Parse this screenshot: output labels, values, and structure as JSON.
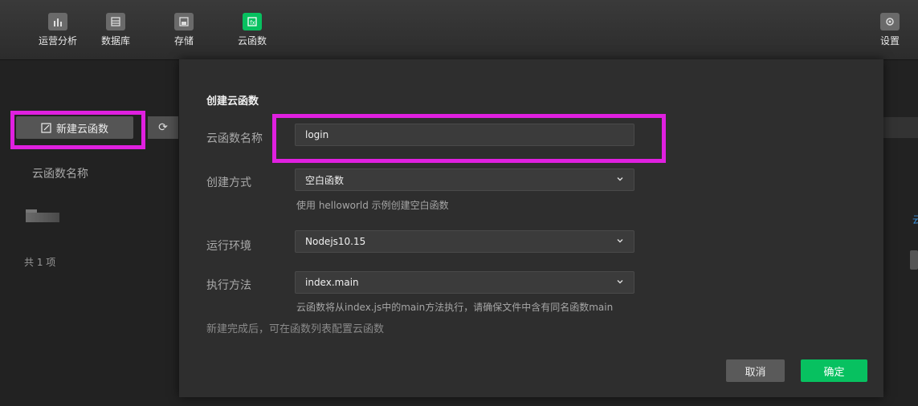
{
  "topnav": {
    "items": [
      {
        "label": "运营分析",
        "icon": "bar-chart-icon"
      },
      {
        "label": "数据库",
        "icon": "database-icon"
      },
      {
        "label": "存储",
        "icon": "storage-icon"
      },
      {
        "label": "云函数",
        "icon": "cloud-function-icon",
        "active": true
      }
    ],
    "settings_label": "设置"
  },
  "background": {
    "new_button_label": "新建云函数",
    "column_header": "云函数名称",
    "total_text": "共 1 项",
    "right_edge_text": "云"
  },
  "dialog": {
    "title": "创建云函数",
    "name_label": "云函数名称",
    "name_value": "login",
    "method_label": "创建方式",
    "method_value": "空白函数",
    "method_hint": "使用 helloworld 示例创建空白函数",
    "runtime_label": "运行环境",
    "runtime_value": "Nodejs10.15",
    "handler_label": "执行方法",
    "handler_value": "index.main",
    "handler_hint": "云函数将从index.js中的main方法执行，请确保文件中含有同名函数main",
    "footnote": "新建完成后，可在函数列表配置云函数",
    "cancel_label": "取消",
    "confirm_label": "确定"
  },
  "colors": {
    "accent": "#07c160",
    "highlight": "#e020e0"
  }
}
